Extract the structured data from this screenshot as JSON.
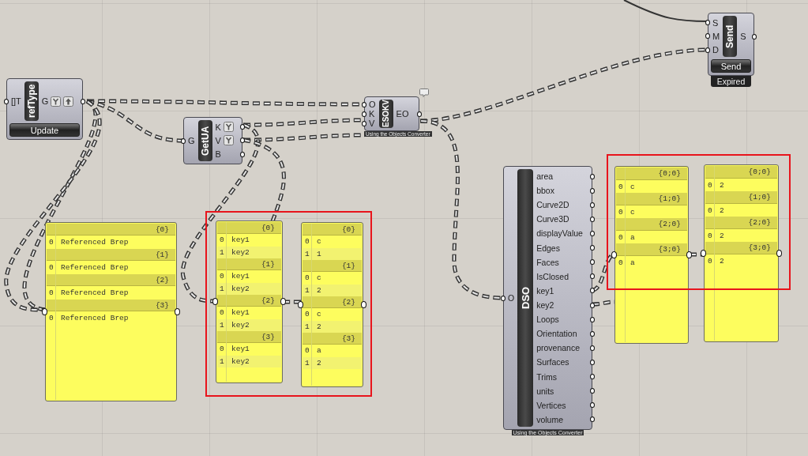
{
  "canvas": {
    "components": [
      {
        "name": "refType",
        "inputs": [
          {
            "label": "[]T"
          }
        ],
        "outputs": [
          {
            "label": "G",
            "graft": true,
            "arrow": true
          }
        ],
        "button": "Update"
      },
      {
        "name": "GetUA",
        "inputs": [
          {
            "label": "G"
          }
        ],
        "outputs": [
          {
            "label": "K",
            "graft": true,
            "arrow": false
          },
          {
            "label": "V",
            "graft": true,
            "arrow": false
          },
          {
            "label": "B",
            "graft": false,
            "arrow": false
          }
        ]
      },
      {
        "name": "ESOKV",
        "inputs": [
          {
            "label": "O"
          },
          {
            "label": "K"
          },
          {
            "label": "V"
          }
        ],
        "outputs": [
          {
            "label": "EO"
          }
        ],
        "caption": "Using the Objects Converter",
        "bubble": true
      },
      {
        "name": "Send",
        "inputs": [
          {
            "label": "S"
          },
          {
            "label": "M"
          },
          {
            "label": "D"
          }
        ],
        "outputs": [
          {
            "label": "S"
          }
        ],
        "button": "Send",
        "status": "Expired"
      },
      {
        "name": "DSO",
        "inputs": [
          {
            "label": "O"
          }
        ],
        "outputs": [
          {
            "label": "area"
          },
          {
            "label": "bbox"
          },
          {
            "label": "Curve2D"
          },
          {
            "label": "Curve3D"
          },
          {
            "label": "displayValue"
          },
          {
            "label": "Edges"
          },
          {
            "label": "Faces"
          },
          {
            "label": "IsClosed"
          },
          {
            "label": "key1"
          },
          {
            "label": "key2"
          },
          {
            "label": "Loops"
          },
          {
            "label": "Orientation"
          },
          {
            "label": "provenance"
          },
          {
            "label": "Surfaces"
          },
          {
            "label": "Trims"
          },
          {
            "label": "units"
          },
          {
            "label": "Vertices"
          },
          {
            "label": "volume"
          }
        ],
        "caption": "Using the Objects Converter"
      }
    ],
    "panels": [
      {
        "branches": [
          {
            "path": "{0}",
            "items": [
              {
                "index": "0",
                "value": "Referenced Brep"
              }
            ]
          },
          {
            "path": "{1}",
            "items": [
              {
                "index": "0",
                "value": "Referenced Brep"
              }
            ]
          },
          {
            "path": "{2}",
            "items": [
              {
                "index": "0",
                "value": "Referenced Brep"
              }
            ]
          },
          {
            "path": "{3}",
            "items": [
              {
                "index": "0",
                "value": "Referenced Brep"
              }
            ]
          }
        ]
      },
      {
        "branches": [
          {
            "path": "{0}",
            "items": [
              {
                "index": "0",
                "value": "key1"
              },
              {
                "index": "1",
                "value": "key2"
              }
            ]
          },
          {
            "path": "{1}",
            "items": [
              {
                "index": "0",
                "value": "key1"
              },
              {
                "index": "1",
                "value": "key2"
              }
            ]
          },
          {
            "path": "{2}",
            "items": [
              {
                "index": "0",
                "value": "key1"
              },
              {
                "index": "1",
                "value": "key2"
              }
            ]
          },
          {
            "path": "{3}",
            "items": [
              {
                "index": "0",
                "value": "key1"
              },
              {
                "index": "1",
                "value": "key2"
              }
            ]
          }
        ]
      },
      {
        "branches": [
          {
            "path": "{0}",
            "items": [
              {
                "index": "0",
                "value": "c"
              },
              {
                "index": "1",
                "value": "1"
              }
            ]
          },
          {
            "path": "{1}",
            "items": [
              {
                "index": "0",
                "value": "c"
              },
              {
                "index": "1",
                "value": "2"
              }
            ]
          },
          {
            "path": "{2}",
            "items": [
              {
                "index": "0",
                "value": "c"
              },
              {
                "index": "1",
                "value": "2"
              }
            ]
          },
          {
            "path": "{3}",
            "items": [
              {
                "index": "0",
                "value": "a"
              },
              {
                "index": "1",
                "value": "2"
              }
            ]
          }
        ]
      },
      {
        "branches": [
          {
            "path": "{0;0}",
            "items": [
              {
                "index": "0",
                "value": "c"
              }
            ]
          },
          {
            "path": "{1;0}",
            "items": [
              {
                "index": "0",
                "value": "c"
              }
            ]
          },
          {
            "path": "{2;0}",
            "items": [
              {
                "index": "0",
                "value": "a"
              }
            ]
          },
          {
            "path": "{3;0}",
            "items": [
              {
                "index": "0",
                "value": "a"
              }
            ]
          }
        ]
      },
      {
        "branches": [
          {
            "path": "{0;0}",
            "items": [
              {
                "index": "0",
                "value": "2"
              }
            ]
          },
          {
            "path": "{1;0}",
            "items": [
              {
                "index": "0",
                "value": "2"
              }
            ]
          },
          {
            "path": "{2;0}",
            "items": [
              {
                "index": "0",
                "value": "2"
              }
            ]
          },
          {
            "path": "{3;0}",
            "items": [
              {
                "index": "0",
                "value": "2"
              }
            ]
          }
        ]
      }
    ]
  }
}
